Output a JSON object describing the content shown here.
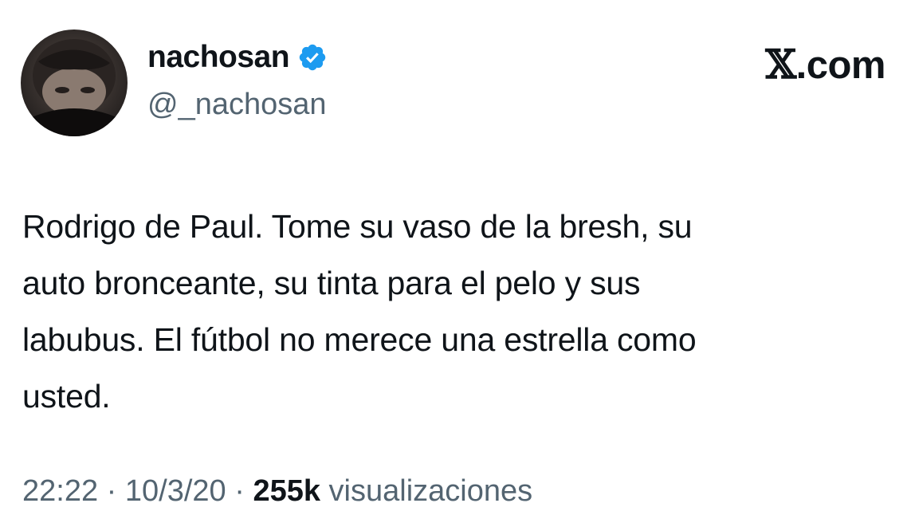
{
  "author": {
    "display_name": "nachosan",
    "handle": "@_nachosan",
    "verified_color": "#1d9bf0"
  },
  "brand": {
    "x_glyph": "𝕏",
    "suffix": ".com"
  },
  "tweet": {
    "lines": [
      "Rodrigo de Paul. Tome su vaso de la bresh, su",
      "auto bronceante, su tinta para el pelo y sus",
      "labubus. El fútbol no merece una estrella como",
      "usted."
    ]
  },
  "meta": {
    "time": "22:22 · 10/3/20",
    "views": "255k",
    "views_label": "visualizaciones"
  },
  "icons": [
    "avatar-photo",
    "verified-badge-icon",
    "x-logo-icon"
  ]
}
